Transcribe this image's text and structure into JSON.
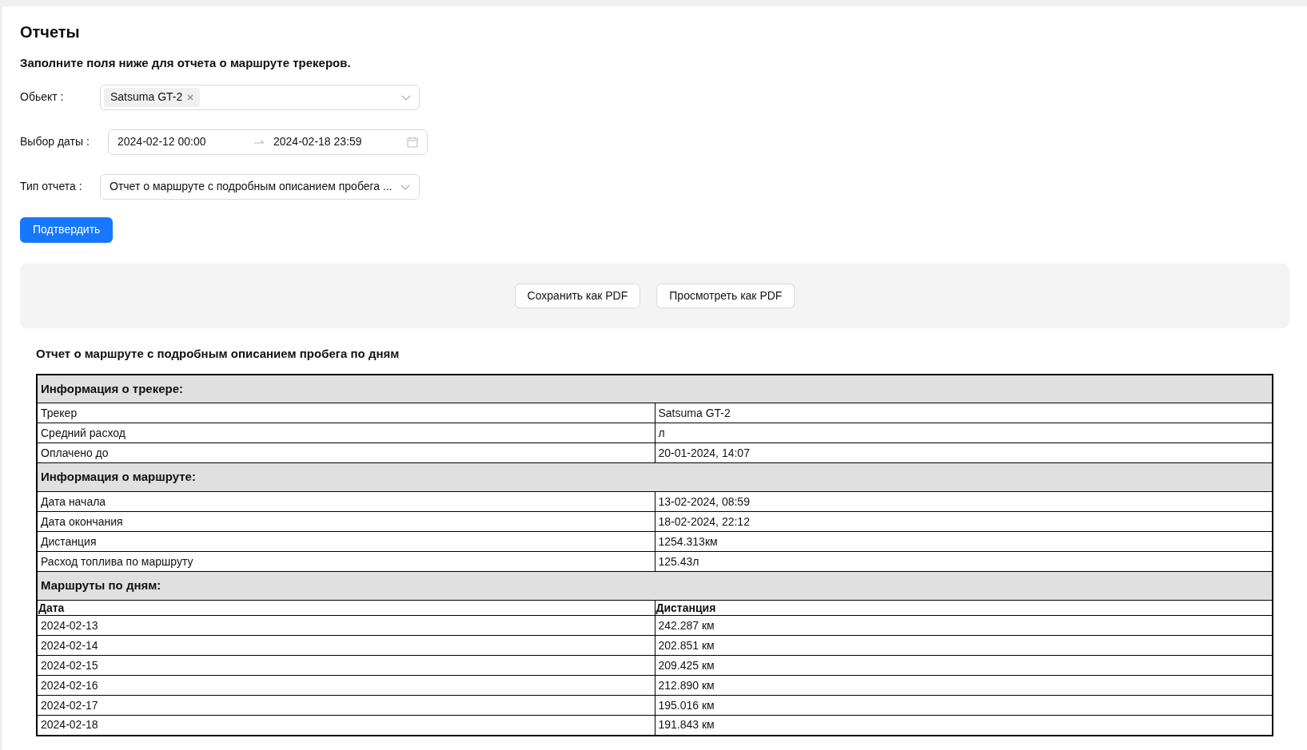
{
  "page_title": "Отчеты",
  "instructions": "Заполните поля ниже для отчета о маршруте трекеров.",
  "form": {
    "object": {
      "label": "Обьект :",
      "tags": [
        "Satsuma GT-2"
      ]
    },
    "date_range": {
      "label": "Выбор даты :",
      "start": "2024-02-12 00:00",
      "end": "2024-02-18 23:59"
    },
    "report_type": {
      "label": "Тип отчета :",
      "value": "Отчет о маршруте с подробным описанием пробега ..."
    },
    "submit": "Подтвердить"
  },
  "export_buttons": [
    "Сохранить как PDF",
    "Просмотреть как PDF"
  ],
  "report_title": "Отчет о маршруте с подробным описанием пробега по дням",
  "report_rows": [
    {
      "kind": "section",
      "cells": [
        "Информация о трекере:"
      ]
    },
    {
      "kind": "row",
      "cells": [
        "Трекер",
        "Satsuma GT-2"
      ]
    },
    {
      "kind": "row",
      "cells": [
        "Средний расход",
        "л"
      ]
    },
    {
      "kind": "row",
      "cells": [
        "Оплачено до",
        "20-01-2024, 14:07"
      ]
    },
    {
      "kind": "section",
      "cells": [
        "Информация о маршруте:"
      ]
    },
    {
      "kind": "row",
      "cells": [
        "Дата начала",
        "13-02-2024, 08:59"
      ]
    },
    {
      "kind": "row",
      "cells": [
        "Дата окончания",
        "18-02-2024, 22:12"
      ]
    },
    {
      "kind": "row",
      "cells": [
        "Дистанция",
        "1254.313км"
      ]
    },
    {
      "kind": "row",
      "cells": [
        "Расход топлива по маршруту",
        "125.43л"
      ]
    },
    {
      "kind": "section",
      "cells": [
        "Маршруты по дням:"
      ]
    },
    {
      "kind": "header",
      "cells": [
        "Дата",
        "Дистанция"
      ]
    },
    {
      "kind": "row",
      "cells": [
        "2024-02-13",
        "242.287 км"
      ]
    },
    {
      "kind": "row",
      "cells": [
        "2024-02-14",
        "202.851 км"
      ]
    },
    {
      "kind": "row",
      "cells": [
        "2024-02-15",
        "209.425 км"
      ]
    },
    {
      "kind": "row",
      "cells": [
        "2024-02-16",
        "212.890 км"
      ]
    },
    {
      "kind": "row",
      "cells": [
        "2024-02-17",
        "195.016 км"
      ]
    },
    {
      "kind": "row",
      "cells": [
        "2024-02-18",
        "191.843 км"
      ]
    }
  ]
}
